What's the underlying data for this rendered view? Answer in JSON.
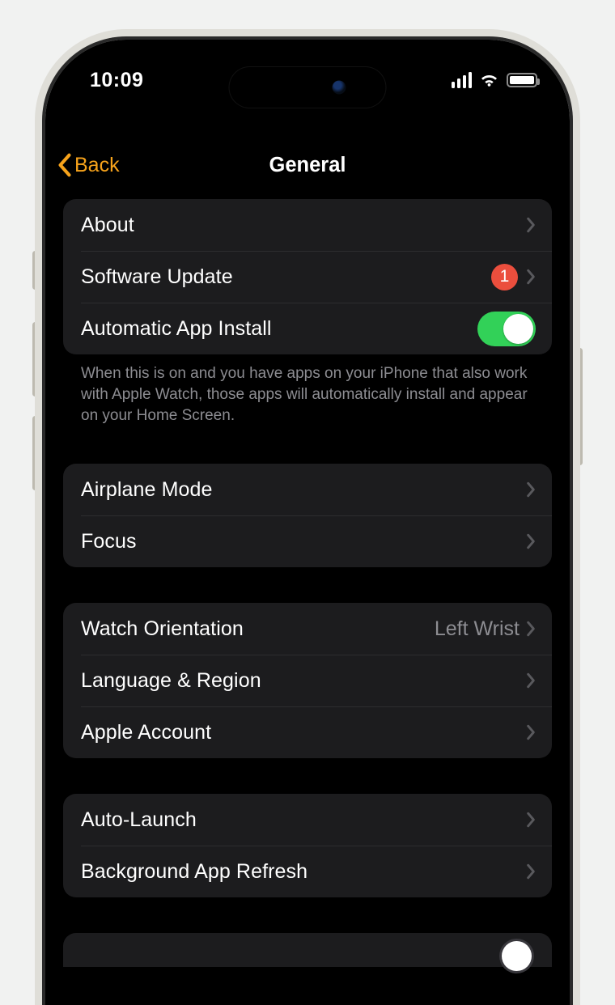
{
  "status": {
    "time": "10:09"
  },
  "nav": {
    "title": "General",
    "back": "Back"
  },
  "accent_color": "#f7a31b",
  "groups": [
    {
      "id": "g1",
      "rows": [
        {
          "id": "about",
          "label": "About",
          "chevron": true
        },
        {
          "id": "software-update",
          "label": "Software Update",
          "badge": "1",
          "chevron": true
        },
        {
          "id": "auto-install",
          "label": "Automatic App Install",
          "toggle": true,
          "toggle_on": true
        }
      ],
      "footer": "When this is on and you have apps on your iPhone that also work with Apple Watch, those apps will automatically install and appear on your Home Screen."
    },
    {
      "id": "g2",
      "rows": [
        {
          "id": "airplane",
          "label": "Airplane Mode",
          "chevron": true
        },
        {
          "id": "focus",
          "label": "Focus",
          "chevron": true
        }
      ]
    },
    {
      "id": "g3",
      "rows": [
        {
          "id": "orientation",
          "label": "Watch Orientation",
          "value": "Left Wrist",
          "chevron": true
        },
        {
          "id": "language",
          "label": "Language & Region",
          "chevron": true
        },
        {
          "id": "apple-account",
          "label": "Apple Account",
          "chevron": true
        }
      ]
    },
    {
      "id": "g4",
      "rows": [
        {
          "id": "auto-launch",
          "label": "Auto-Launch",
          "chevron": true
        },
        {
          "id": "bg-refresh",
          "label": "Background App Refresh",
          "chevron": true
        }
      ]
    }
  ]
}
